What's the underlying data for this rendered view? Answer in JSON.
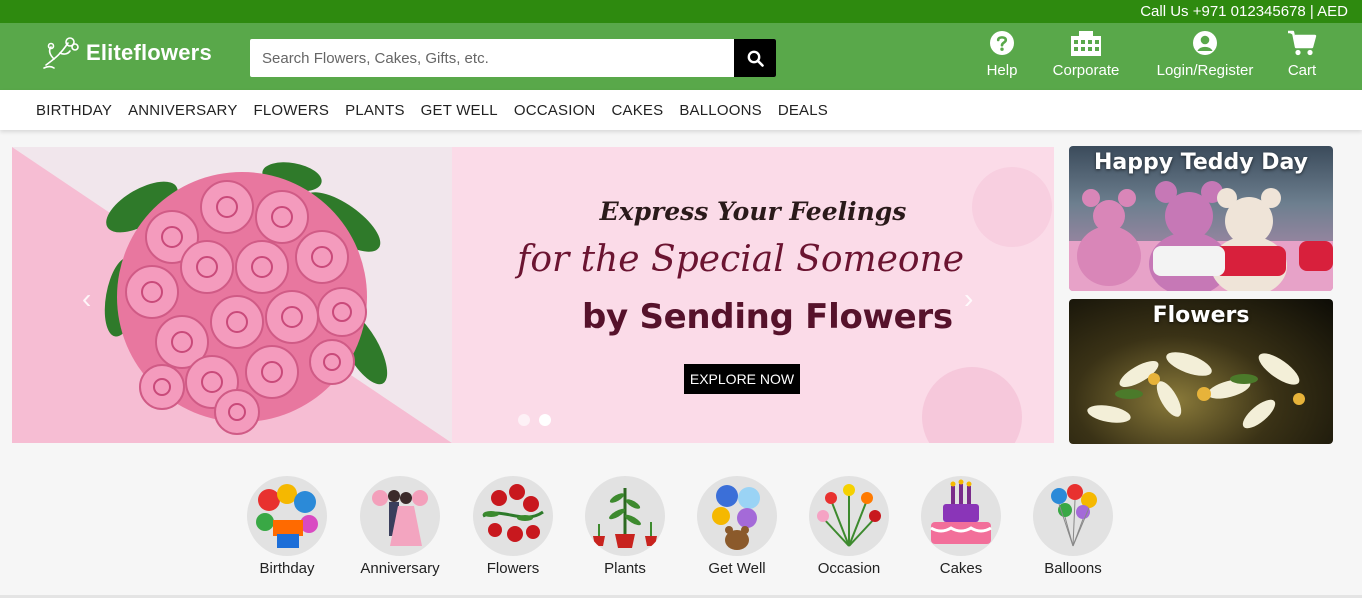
{
  "topbar": {
    "contact": "Call Us +971 012345678 | AED"
  },
  "brand": {
    "name": "Eliteflowers"
  },
  "search": {
    "placeholder": "Search Flowers, Cakes, Gifts, etc."
  },
  "header_nav": [
    {
      "label": "Help",
      "icon": "question-circle-icon"
    },
    {
      "label": "Corporate",
      "icon": "building-icon"
    },
    {
      "label": "Login/Register",
      "icon": "user-circle-icon"
    },
    {
      "label": "Cart",
      "icon": "cart-icon"
    }
  ],
  "main_nav": [
    "BIRTHDAY",
    "ANNIVERSARY",
    "FLOWERS",
    "PLANTS",
    "GET WELL",
    "OCCASION",
    "CAKES",
    "BALLOONS",
    "DEALS"
  ],
  "hero": {
    "line1": "Express Your Feelings",
    "line2": "for the Special Someone",
    "line3": "by Sending Flowers",
    "cta": "EXPLORE NOW",
    "slides": 2,
    "active_slide": 2
  },
  "side_banners": [
    {
      "title": "Happy Teddy Day"
    },
    {
      "title": "Flowers"
    }
  ],
  "categories": [
    {
      "label": "Birthday"
    },
    {
      "label": "Anniversary"
    },
    {
      "label": "Flowers"
    },
    {
      "label": "Plants"
    },
    {
      "label": "Get Well"
    },
    {
      "label": "Occasion"
    },
    {
      "label": "Cakes"
    },
    {
      "label": "Balloons"
    }
  ],
  "colors": {
    "topbar": "#2e8a0f",
    "header": "#59a84a",
    "hero_text": "#6b1431",
    "cta": "#000000"
  }
}
